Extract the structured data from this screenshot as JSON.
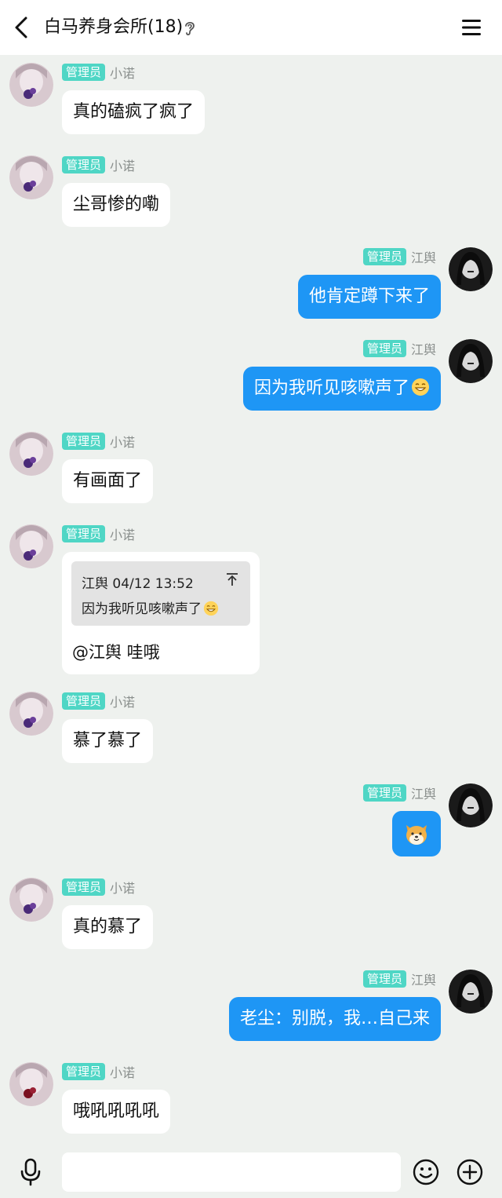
{
  "header": {
    "title": "白马养身会所(18)",
    "back_icon": "chevron-left-icon",
    "ear_icon": "ear-icon",
    "menu_icon": "hamburger-menu-icon"
  },
  "badge_label": "管理员",
  "messages": [
    {
      "side": "left",
      "name": "小诺",
      "text": "真的磕疯了疯了"
    },
    {
      "side": "left",
      "name": "小诺",
      "text": "尘哥惨的嘞"
    },
    {
      "side": "right",
      "name": "江舆",
      "text": "他肯定蹲下来了"
    },
    {
      "side": "right",
      "name": "江舆",
      "text": "因为我听见咳嗽声了",
      "emoji": "grin-face-emoji"
    },
    {
      "side": "left",
      "name": "小诺",
      "text": "有画面了"
    },
    {
      "side": "left",
      "name": "小诺",
      "quote": {
        "header": "江舆 04/12 13:52",
        "text": "因为我听见咳嗽声了",
        "emoji": "grin-face-emoji",
        "pin_icon": "pin-top-icon"
      },
      "reply": "@江舆 哇哦"
    },
    {
      "side": "left",
      "name": "小诺",
      "text": "慕了慕了"
    },
    {
      "side": "right",
      "name": "江舆",
      "sticker": "shiba-dog-emoji"
    },
    {
      "side": "left",
      "name": "小诺",
      "text": "真的慕了"
    },
    {
      "side": "right",
      "name": "江舆",
      "text": "老尘：别脱，我…自己来"
    },
    {
      "side": "left",
      "name": "小诺",
      "text": "哦吼吼吼吼"
    }
  ],
  "composer": {
    "mic_icon": "microphone-icon",
    "input_value": "",
    "emoji_icon": "smiley-icon",
    "plus_icon": "plus-circle-icon"
  },
  "colors": {
    "badge": "#4fd6c5",
    "outgoing_bubble": "#1e96f5",
    "incoming_bubble": "#ffffff",
    "chat_background": "#eef1ee"
  }
}
